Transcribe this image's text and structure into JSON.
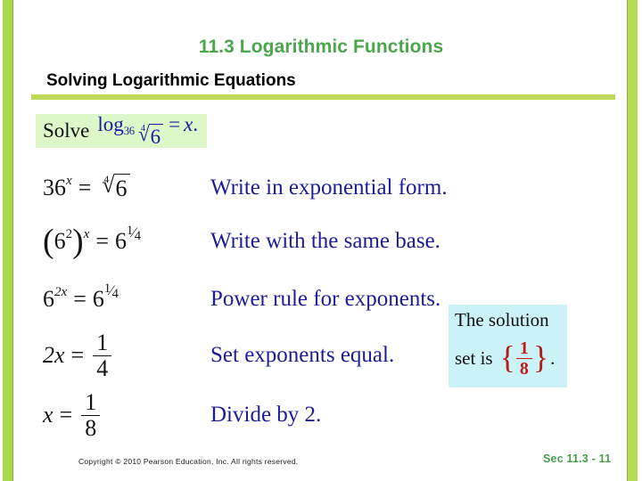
{
  "slide": {
    "title": "11.3 Logarithmic Functions",
    "subtitle": "Solving Logarithmic Equations",
    "title_color": "#4ca64c",
    "rule_color": "#bcd95a",
    "strip_color": "#a9d84e",
    "background": "#ffffff"
  },
  "problem": {
    "label": "Solve",
    "box_color": "#ddf7c8",
    "expression_color": "#1a1a9e",
    "log_word": "log",
    "log_base": "36",
    "radical_index": "4",
    "radicand": "6",
    "equals": "=",
    "variable": "x",
    "period": "."
  },
  "steps": [
    {
      "equation_parts": {
        "base": "36",
        "exponent": "x",
        "equals": "=",
        "radical_index": "4",
        "radicand": "6"
      },
      "reason": "Write in exponential form."
    },
    {
      "equation_parts": {
        "open_paren": "(",
        "inner_base": "6",
        "inner_exponent": "2",
        "close_paren": ")",
        "outer_exponent": "x",
        "equals": "=",
        "rhs_base": "6",
        "rhs_num": "1",
        "rhs_slash": "⁄",
        "rhs_den": "4"
      },
      "reason": "Write with the same base."
    },
    {
      "equation_parts": {
        "base": "6",
        "exponent": "2x",
        "equals": "=",
        "rhs_base": "6",
        "rhs_num": "1",
        "rhs_slash": "⁄",
        "rhs_den": "4"
      },
      "reason": "Power rule for exponents."
    },
    {
      "equation_parts": {
        "lhs": "2x",
        "equals": "=",
        "num": "1",
        "den": "4"
      },
      "reason": "Set exponents equal."
    },
    {
      "equation_parts": {
        "lhs": "x",
        "equals": "=",
        "num": "1",
        "den": "8"
      },
      "reason": "Divide by 2."
    }
  ],
  "callout": {
    "line1": "The solution",
    "line2_prefix": "set is",
    "open_brace": "{",
    "close_brace": "}",
    "num": "1",
    "den": "8",
    "period": ".",
    "box_color": "#cbf2f7",
    "value_color": "#c21b17"
  },
  "footer": {
    "copyright": "Copyright © 2010 Pearson Education, Inc.  All rights reserved.",
    "section": "Sec 11.3 - 11",
    "section_color": "#4c9a4c"
  }
}
